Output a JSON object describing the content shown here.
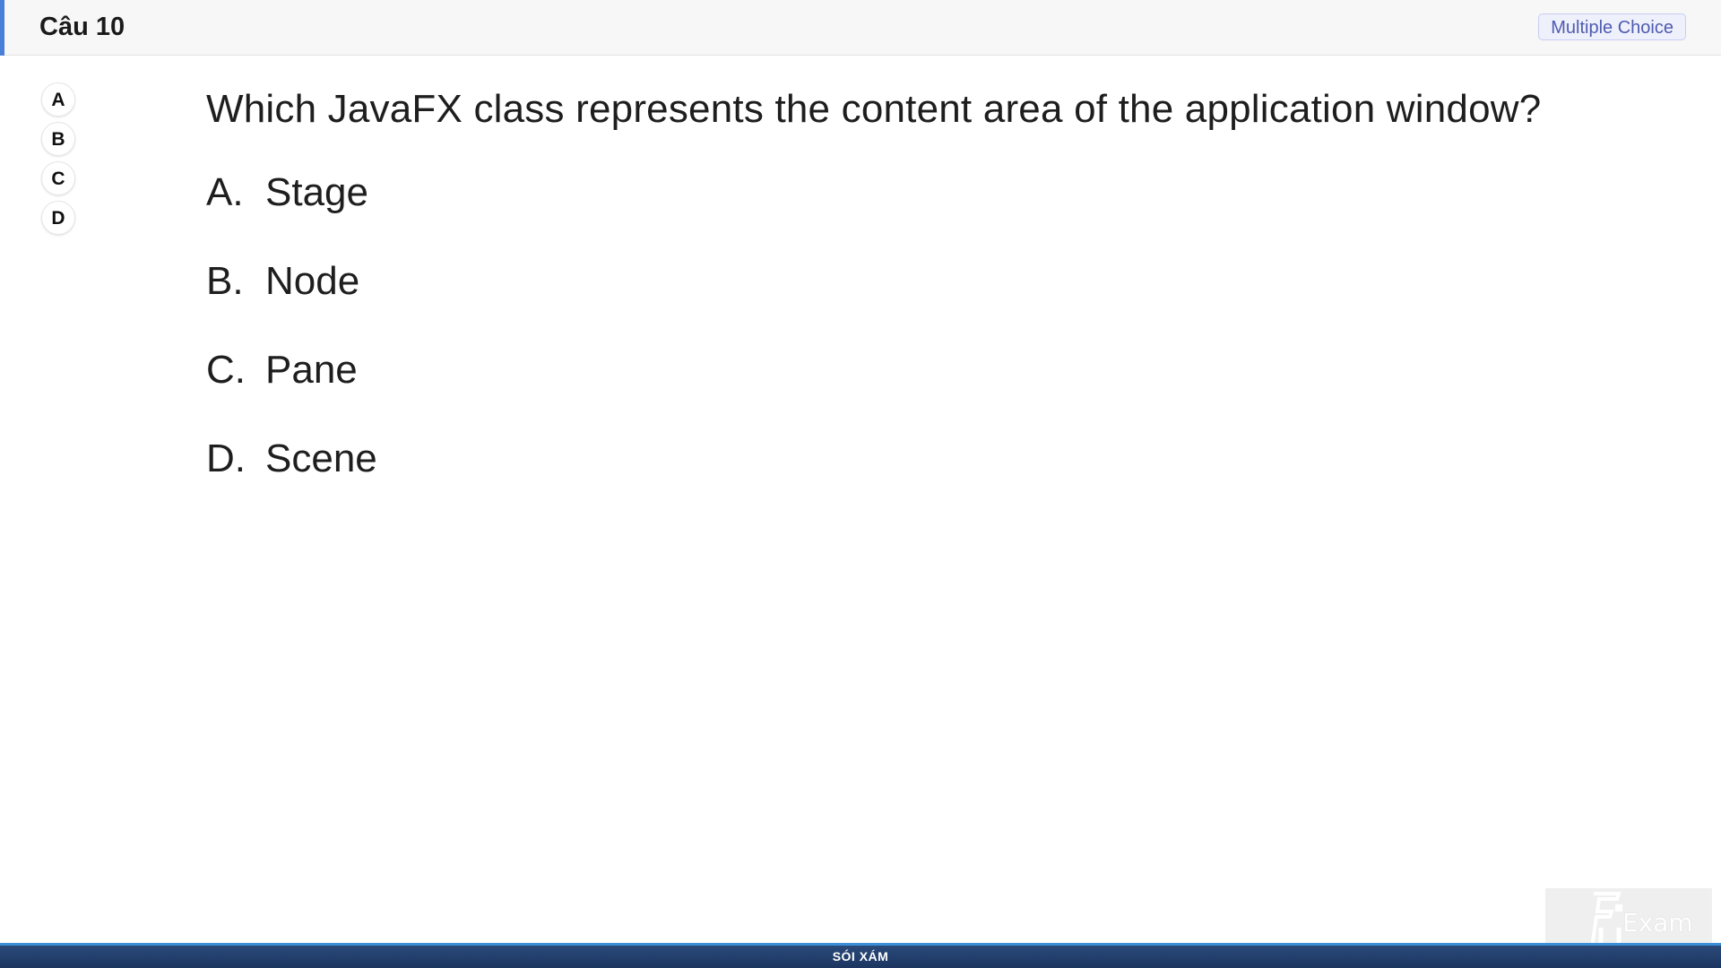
{
  "header": {
    "title": "Câu 10",
    "question_type": "Multiple Choice",
    "accent_color": "#4a7fd9"
  },
  "answer_selector": [
    {
      "label": "A"
    },
    {
      "label": "B"
    },
    {
      "label": "C"
    },
    {
      "label": "D"
    }
  ],
  "question": {
    "text": "Which JavaFX class represents the content area of the application window?",
    "options": [
      {
        "letter": "A.",
        "text": "Stage"
      },
      {
        "letter": "B.",
        "text": "Node"
      },
      {
        "letter": "C.",
        "text": "Pane"
      },
      {
        "letter": "D.",
        "text": "Scene"
      }
    ]
  },
  "footer": {
    "text": "SÓI XÁM",
    "color": "#1c3560"
  },
  "logo": {
    "icon": "fu-logo-icon",
    "text": "Exam"
  }
}
